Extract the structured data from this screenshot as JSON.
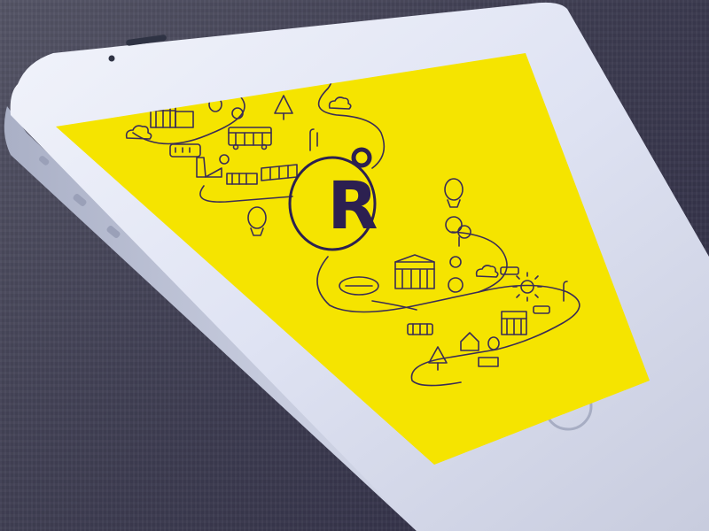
{
  "app": {
    "logo_letter": "R"
  },
  "colors": {
    "screen_background": "#f5e400",
    "line_art": "#3a2c55",
    "logo_ink": "#2c2050",
    "phone_body": "#dfe3f3",
    "background": "#3f3f52"
  },
  "device": {
    "type": "smartphone",
    "orientation": "portrait-tilted"
  },
  "icons": [
    "hot-air-balloon-icon",
    "cloud-icon",
    "tree-icon",
    "car-icon",
    "tram-icon",
    "building-icon",
    "factory-icon",
    "airship-icon",
    "sun-icon",
    "house-icon",
    "lamp-post-icon"
  ]
}
